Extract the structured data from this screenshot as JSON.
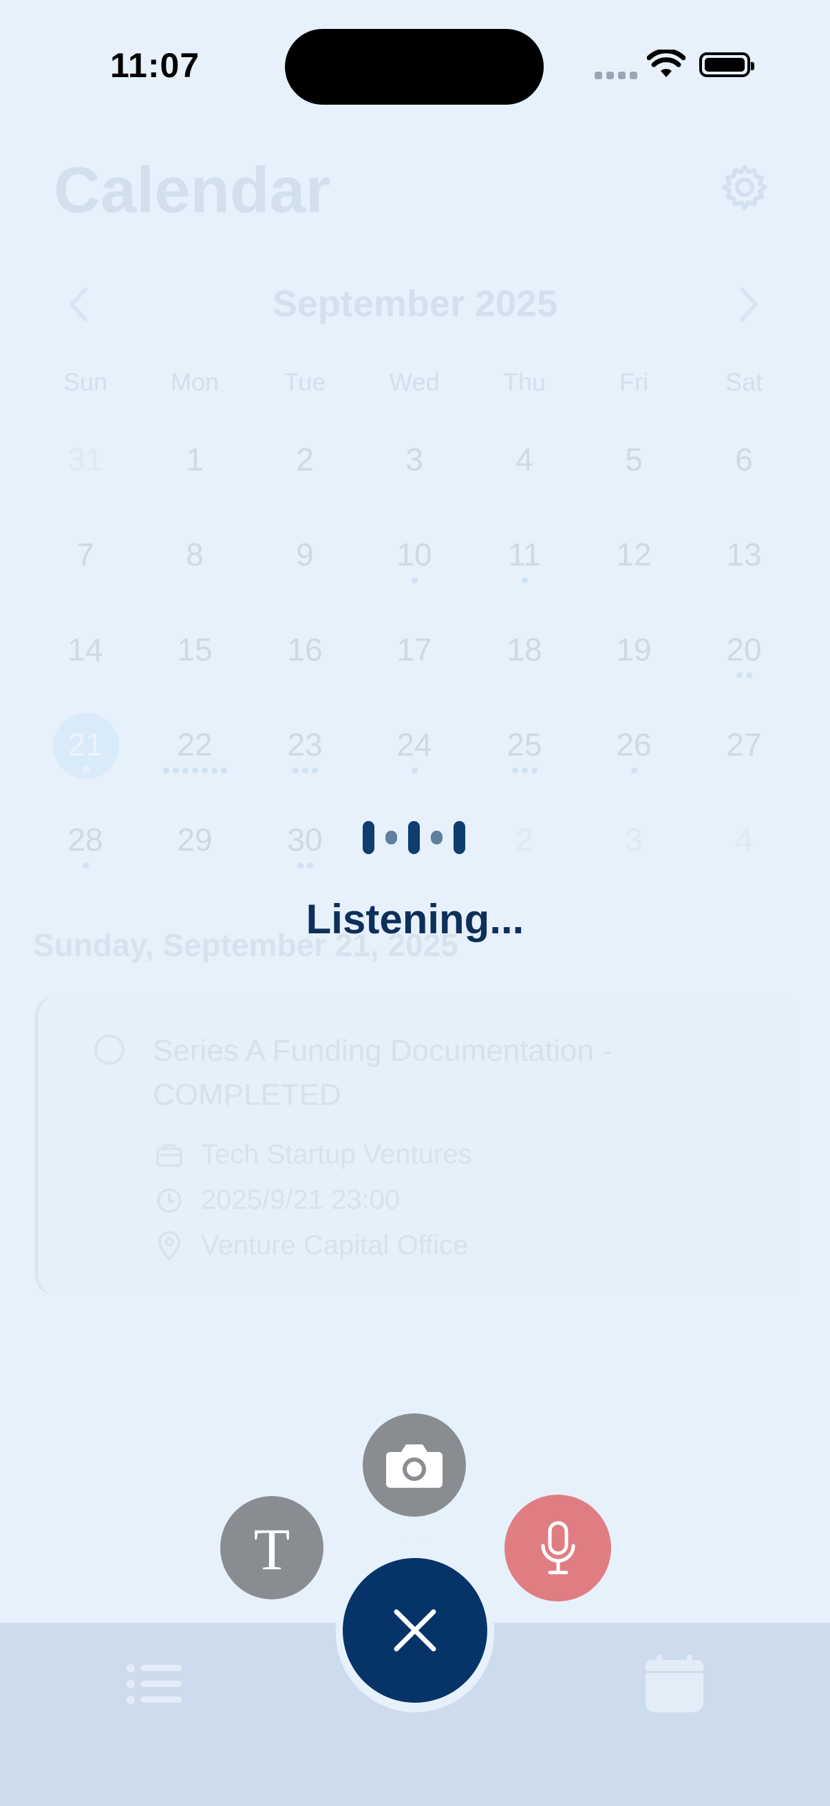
{
  "status_bar": {
    "time": "11:07"
  },
  "header": {
    "title": "Calendar"
  },
  "calendar": {
    "month_label": "September 2025",
    "weekdays": [
      "Sun",
      "Mon",
      "Tue",
      "Wed",
      "Thu",
      "Fri",
      "Sat"
    ],
    "weeks": [
      [
        "31",
        "1",
        "2",
        "3",
        "4",
        "5",
        "6"
      ],
      [
        "7",
        "8",
        "9",
        "10",
        "11",
        "12",
        "13"
      ],
      [
        "14",
        "15",
        "16",
        "17",
        "18",
        "19",
        "20"
      ],
      [
        "21",
        "22",
        "23",
        "24",
        "25",
        "26",
        "27"
      ],
      [
        "28",
        "29",
        "30",
        "1",
        "2",
        "3",
        "4"
      ]
    ],
    "selected_day": "21"
  },
  "selected_date_heading": "Sunday, September 21, 2025",
  "task": {
    "title": "Series A Funding Documentation - COMPLETED",
    "company": "Tech Startup Ventures",
    "datetime": "2025/9/21 23:00",
    "location": "Venture Capital Office"
  },
  "voice": {
    "status": "Listening..."
  },
  "icons": {
    "settings": "gear-icon",
    "prev": "chevron-left-icon",
    "next": "chevron-right-icon",
    "camera": "camera-icon",
    "text": "text-icon",
    "mic": "microphone-icon",
    "close": "close-icon",
    "list": "list-icon",
    "calendar": "calendar-icon",
    "company": "briefcase-icon",
    "time": "clock-icon",
    "location": "location-pin-icon"
  },
  "colors": {
    "background": "#e6f1fb",
    "primary": "#063468",
    "mic_button": "#e07d82",
    "secondary_button": "#898d91",
    "tab_bar": "#cddcec"
  }
}
